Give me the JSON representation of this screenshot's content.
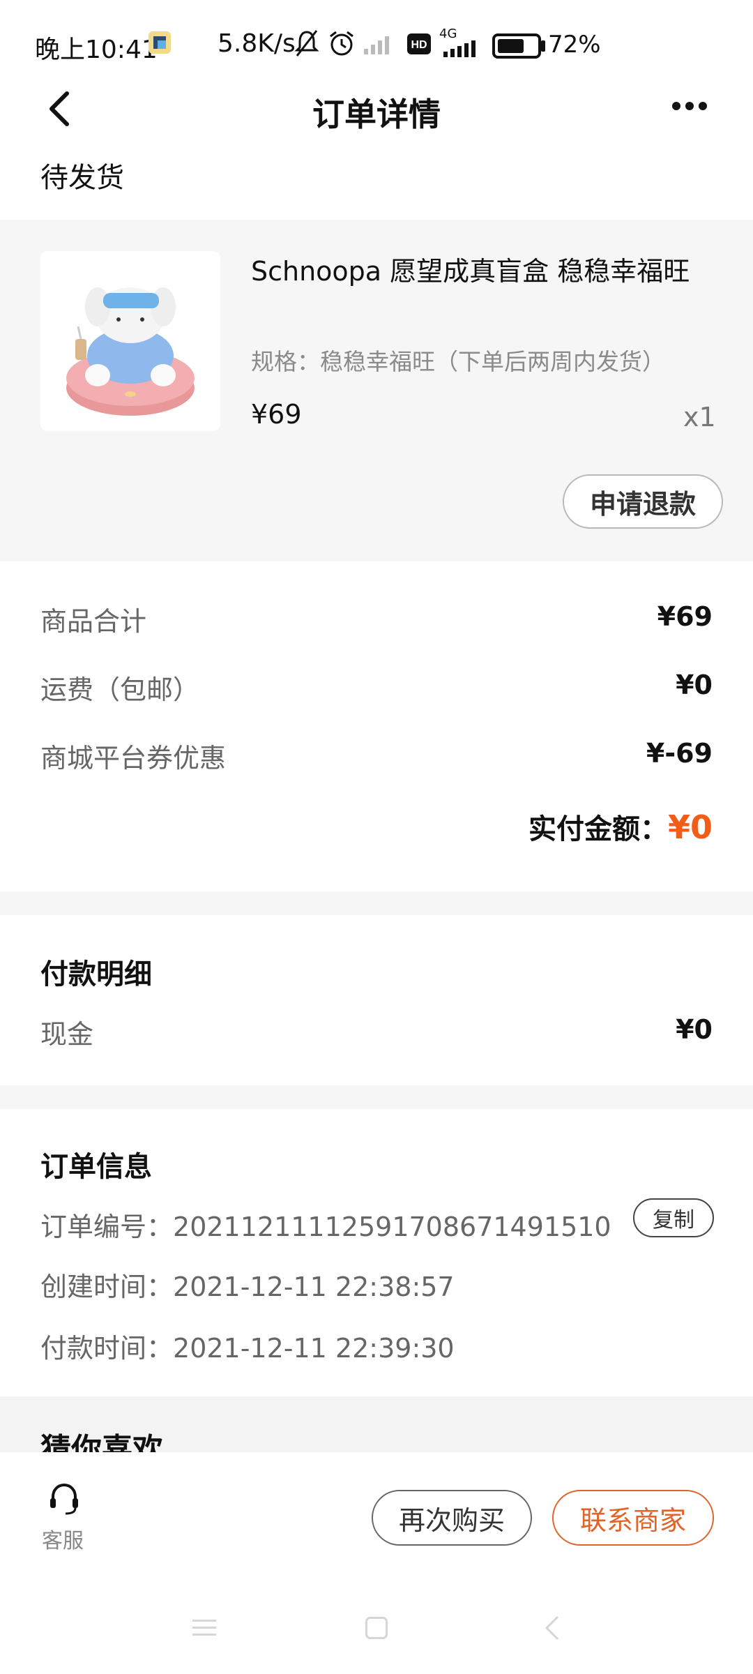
{
  "status_bar": {
    "time": "晚上10:41",
    "speed": "5.8K/s",
    "network": "4G",
    "battery_percent": "72%",
    "battery_level": 0.72
  },
  "header": {
    "title": "订单详情",
    "back_icon": "chevron-left-icon",
    "more_icon": "more-dots-icon"
  },
  "order_status": "待发货",
  "product": {
    "name": "Schnoopa 愿望成真盲盒 稳稳幸福旺",
    "spec": "规格：稳稳幸福旺（下单后两周内发货）",
    "price": "¥69",
    "quantity": "x1",
    "refund_label": "申请退款"
  },
  "summary": {
    "rows": [
      {
        "label": "商品合计",
        "value": "¥69"
      },
      {
        "label": "运费（包邮）",
        "value": "¥0"
      },
      {
        "label": "商城平台券优惠",
        "value": "¥-69"
      }
    ],
    "paid_label": "实付金额：",
    "paid_value": "¥0"
  },
  "payment_detail": {
    "title": "付款明细",
    "method": "现金",
    "amount": "¥0"
  },
  "order_info": {
    "title": "订单信息",
    "number_label": "订单编号：",
    "number_value": "20211211112591708671491510",
    "copy_label": "复制",
    "created_label": "创建时间：",
    "created_value": "2021-12-11 22:38:57",
    "paid_label": "付款时间：",
    "paid_value": "2021-12-11 22:39:30"
  },
  "recommend": {
    "title": "猜你喜欢"
  },
  "bottom_bar": {
    "service_label": "客服",
    "rebuy_label": "再次购买",
    "contact_label": "联系商家"
  },
  "colors": {
    "accent": "#f25c19",
    "contact_border": "#e26328",
    "section_bg": "#f6f6f6"
  }
}
